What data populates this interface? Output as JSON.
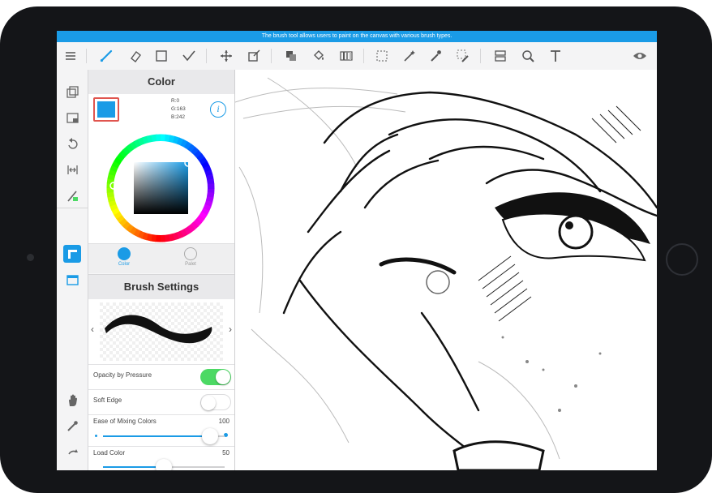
{
  "status_bar": {
    "text": "The brush tool allows users to paint on the canvas with various brush types."
  },
  "toolbar": {
    "icons": [
      "menu-icon",
      "brush-icon",
      "eraser-icon",
      "shape-icon",
      "check-icon",
      "move-icon",
      "transform-icon",
      "fill-layer-icon",
      "bucket-icon",
      "gradient-icon",
      "select-icon",
      "wand-icon",
      "eyedropper-icon",
      "select-pen-icon",
      "layer-icon",
      "zoom-icon",
      "text-icon",
      "eye-icon"
    ]
  },
  "color_panel": {
    "title": "Color",
    "current_color": "#1a9be6",
    "rgb": {
      "r": "R:0",
      "g": "G:163",
      "b": "B:242"
    },
    "tabs": [
      {
        "label": "Color"
      },
      {
        "label": "Palet"
      }
    ]
  },
  "brush_settings": {
    "title": "Brush Settings",
    "opacity_by_pressure": {
      "label": "Opacity by Pressure",
      "on": true
    },
    "soft_edge": {
      "label": "Soft Edge",
      "on": false
    },
    "ease_mixing": {
      "label": "Ease of Mixing Colors",
      "value": "100",
      "fraction": 1.0
    },
    "load_color": {
      "label": "Load Color",
      "value": "50",
      "fraction": 0.5
    }
  },
  "colors": {
    "accent": "#1a9be6",
    "toggle_on": "#4cd964",
    "bezel": "#141518"
  }
}
